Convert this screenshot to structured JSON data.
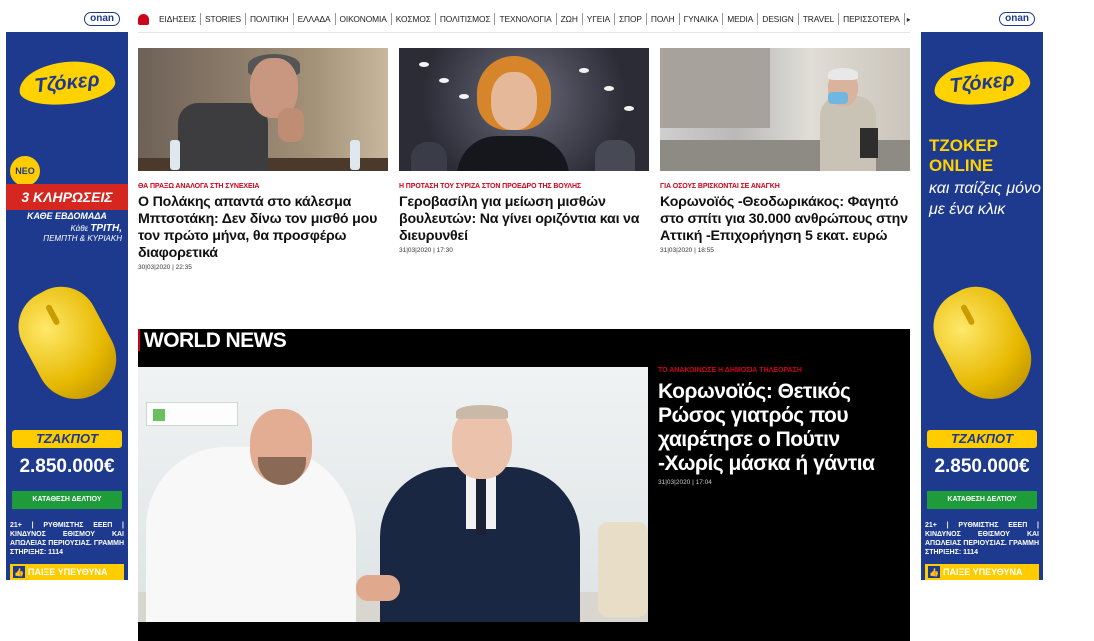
{
  "ad": {
    "sponsor": "onan",
    "brand": "Τζόκερ",
    "left": {
      "badge": "ΝΕΟ",
      "draws": "3 ΚΛΗΡΩΣΕΙΣ",
      "draws_sub": "ΚΑΘΕ ΕΒΔΟΜΑΔΑ",
      "days_prefix": "Κάθε",
      "days_main": "ΤΡΙΤΗ,",
      "days_rest": "ΠΕΜΠΤΗ & ΚΥΡΙΑΚΗ"
    },
    "right": {
      "online": "ΤΖΟΚΕΡ ONLINE",
      "tagline": "και παίζεις μόνο με ένα κλικ"
    },
    "jackpot_label": "ΤΖΑΚΠΟΤ",
    "jackpot_value": "2.850.000€",
    "cta": "ΚΑΤΑΘΕΣΗ ΔΕΛΤΙΟΥ",
    "warning": "21+ | ΡΥΘΜΙΣΤΗΣ ΕΕΕΠ | ΚΙΝΔΥΝΟΣ ΕΘΙΣΜΟΥ ΚΑΙ ΑΠΩΛΕΙΑΣ ΠΕΡΙΟΥΣΙΑΣ. ΓΡΑΜΜΗ ΣΤΗΡΙΞΗΣ: 1114",
    "responsible": "ΠΑΙΞΕ ΥΠΕΥΘΥΝΑ"
  },
  "nav": {
    "items": [
      "ΕΙΔΗΣΕΙΣ",
      "STORIES",
      "ΠΟΛΙΤΙΚΗ",
      "ΕΛΛΑΔΑ",
      "ΟΙΚΟΝΟΜΙΑ",
      "ΚΟΣΜΟΣ",
      "ΠΟΛΙΤΙΣΜΟΣ",
      "ΤΕΧΝΟΛΟΓΙΑ",
      "ΖΩΗ",
      "ΥΓΕΙΑ",
      "ΣΠΟΡ",
      "ΠΟΛΗ",
      "ΓΥΝΑΙΚΑ",
      "MEDIA",
      "DESIGN",
      "TRAVEL",
      "ΠΕΡΙΣΣΟΤΕΡΑ"
    ],
    "more_glyph": "▸"
  },
  "articles": [
    {
      "kicker": "ΘΑ ΠΡΑΞΩ ΑΝΑΛΟΓΑ ΣΤΗ ΣΥΝΕΧΕΙΑ",
      "title": "Ο Πολάκης απαντά στο κάλεσμα Μπτσοτάκη: Δεν δίνω τον μισθό μου τον πρώτο μήνα, θα προσφέρω διαφορετικά",
      "date": "30|03|2020 | 22:35"
    },
    {
      "kicker": "Η ΠΡΟΤΑΣΗ ΤΟΥ ΣΥΡΙΖΑ ΣΤΟΝ ΠΡΟΕΔΡΟ ΤΗΣ ΒΟΥΛΗΣ",
      "title": "Γεροβασίλη για μείωση μισθών βουλευτών: Να γίνει οριζόντια και να διευρυνθεί",
      "date": "31|03|2020 | 17:30"
    },
    {
      "kicker": "ΓΙΑ ΟΣΟΥΣ ΒΡΙΣΚΟΝΤΑΙ ΣΕ ΑΝΑΓΚΗ",
      "title": "Κορωνοϊός -Θεοδωρικάκος: Φαγητό στο σπίτι για 30.000 ανθρώπους στην Αττική -Επιχορήγηση 5 εκατ. ευρώ",
      "date": "31|03|2020 | 18:55"
    }
  ],
  "world": {
    "label": "WORLD NEWS",
    "kicker": "ΤΟ ΑΝΑΚΟΙΝΩΣΕ Η ΔΗΜΟΣΙΑ ΤΗΛΕΟΡΑΣΗ",
    "headline": "Κορωνοϊός: Θετικός Ρώσος γιατρός που χαιρέτησε ο Πούτιν -Χωρίς μάσκα ή γάντια",
    "date": "31|03|2020 | 17:04"
  }
}
